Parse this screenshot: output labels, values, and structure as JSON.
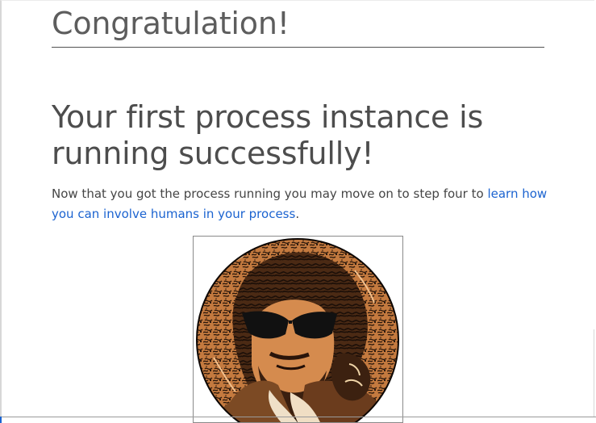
{
  "page": {
    "heading": "Congratulation!",
    "subheading": "Your first process instance is running successfully!",
    "paragraph_before_link": "Now that you got the process running you may move on to step four to ",
    "link_text": "learn how you can involve humans in your process",
    "paragraph_after_link": "."
  },
  "colors": {
    "heading": "#5d5d5d",
    "text": "#454545",
    "link": "#1b63d0",
    "divider": "#525252",
    "portrait_background": "#c47a3f"
  },
  "image": {
    "description": "circular portrait illustration",
    "icon": "portrait-image"
  }
}
